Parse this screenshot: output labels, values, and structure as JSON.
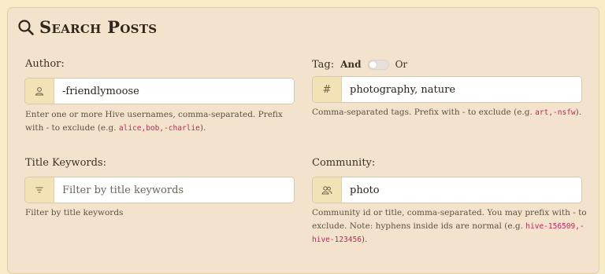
{
  "header": {
    "title": "Search Posts"
  },
  "author": {
    "label": "Author:",
    "value": "-friendlymoose",
    "placeholder": "",
    "help_before": "Enter one or more Hive usernames, comma-separated. Prefix with - to exclude (e.g. ",
    "help_code": "alice,bob,-charlie",
    "help_after": ")."
  },
  "tag": {
    "label": "Tag:",
    "and_label": "And",
    "or_label": "Or",
    "addon": "#",
    "value": "photography, nature",
    "placeholder": "",
    "help_before": "Comma-separated tags. Prefix with - to exclude (e.g. ",
    "help_code": "art,-nsfw",
    "help_after": ")."
  },
  "title_keywords": {
    "label": "Title Keywords:",
    "value": "",
    "placeholder": "Filter by title keywords",
    "help": "Filter by title keywords"
  },
  "community": {
    "label": "Community:",
    "value": "photo",
    "placeholder": "",
    "help_before": "Community id or title, comma-separated. You may prefix with - to exclude. Note: hyphens inside ids are normal (e.g. ",
    "help_code": "hive-156509,-hive-123456",
    "help_after": ")."
  }
}
